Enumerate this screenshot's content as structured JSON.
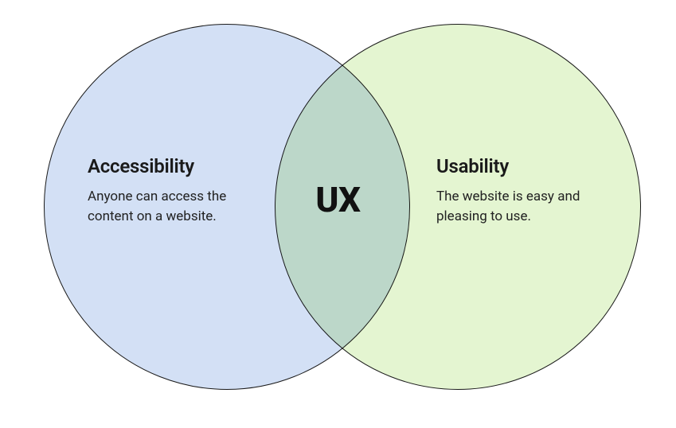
{
  "venn": {
    "left": {
      "title": "Accessibility",
      "description": "Anyone can access the content on a website.",
      "color": "#d3e0f5"
    },
    "right": {
      "title": "Usability",
      "description": "The website is easy and pleasing to use.",
      "color": "#e4f5d1"
    },
    "center": {
      "label": "UX"
    }
  },
  "chart_data": {
    "type": "venn",
    "sets": [
      {
        "name": "Accessibility",
        "description": "Anyone can access the content on a website."
      },
      {
        "name": "Usability",
        "description": "The website is easy and pleasing to use."
      }
    ],
    "intersection": {
      "label": "UX"
    },
    "title": ""
  }
}
